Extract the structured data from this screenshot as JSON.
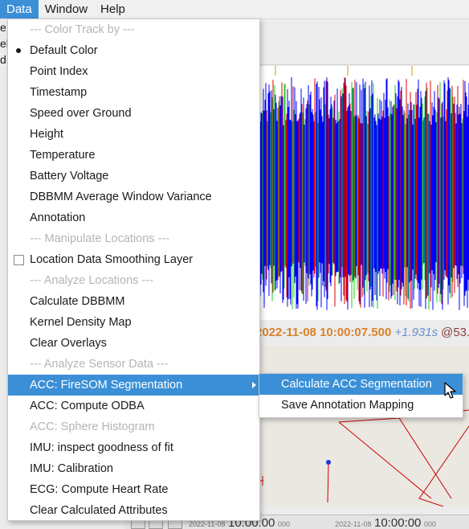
{
  "menubar": {
    "items": [
      {
        "label": "Data",
        "active": true
      },
      {
        "label": "Window",
        "active": false
      },
      {
        "label": "Help",
        "active": false
      }
    ]
  },
  "background": {
    "left_cut_text": [
      "e",
      "el",
      "d"
    ],
    "timestamp": "2022-11-08 10:00:07.500",
    "delta": "+1.931s",
    "at": "@53.",
    "bottom_timeline": {
      "left_date": "2022-11-08",
      "left_time": "10:00:00",
      "left_ms": "000",
      "right_date": "2022-11-08",
      "right_time": "10:00:00",
      "right_ms": "000"
    }
  },
  "data_menu": {
    "items": [
      {
        "label": "--- Color Track by ---",
        "kind": "section"
      },
      {
        "label": "Default Color",
        "kind": "radio-selected"
      },
      {
        "label": "Point Index",
        "kind": "item"
      },
      {
        "label": "Timestamp",
        "kind": "item"
      },
      {
        "label": "Speed over Ground",
        "kind": "item"
      },
      {
        "label": "Height",
        "kind": "item"
      },
      {
        "label": "Temperature",
        "kind": "item"
      },
      {
        "label": "Battery Voltage",
        "kind": "item"
      },
      {
        "label": "DBBMM Average Window Variance",
        "kind": "item"
      },
      {
        "label": "Annotation",
        "kind": "item"
      },
      {
        "label": "--- Manipulate Locations ---",
        "kind": "section"
      },
      {
        "label": "Location Data Smoothing Layer",
        "kind": "checkbox"
      },
      {
        "label": "--- Analyze Locations ---",
        "kind": "section"
      },
      {
        "label": "Calculate DBBMM",
        "kind": "item"
      },
      {
        "label": "Kernel Density Map",
        "kind": "item"
      },
      {
        "label": "Clear Overlays",
        "kind": "item"
      },
      {
        "label": "--- Analyze Sensor Data ---",
        "kind": "section"
      },
      {
        "label": "ACC: FireSOM Segmentation",
        "kind": "submenu-highlight"
      },
      {
        "label": "ACC: Compute ODBA",
        "kind": "item"
      },
      {
        "label": "ACC: Sphere Histogram",
        "kind": "disabled"
      },
      {
        "label": "IMU: inspect goodness of fit",
        "kind": "item"
      },
      {
        "label": "IMU: Calibration",
        "kind": "item"
      },
      {
        "label": "ECG: Compute Heart Rate",
        "kind": "item"
      },
      {
        "label": "Clear Calculated Attributes",
        "kind": "item"
      }
    ]
  },
  "submenu": {
    "items": [
      {
        "label": "Calculate ACC Segmentation",
        "highlight": true
      },
      {
        "label": "Save Annotation Mapping",
        "highlight": false
      }
    ]
  },
  "colors": {
    "menu_highlight": "#3a8fd6",
    "plot_blue": "#0000ff",
    "plot_green": "#22cc22",
    "plot_red": "#dd0000",
    "timestamp_orange": "#d9822b",
    "map_track_red": "#cc0000"
  }
}
